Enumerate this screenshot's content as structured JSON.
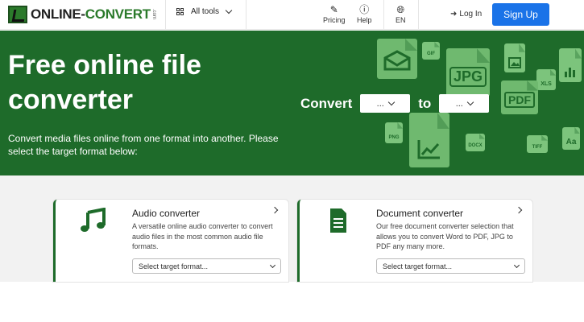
{
  "header": {
    "logo_text_a": "ONLINE-",
    "logo_text_b": "CONVERT",
    "logo_sub": ".com",
    "all_tools": "All tools",
    "pricing": "Pricing",
    "help": "Help",
    "lang": "EN",
    "login": "Log In",
    "signup": "Sign Up",
    "accent": "#1a73e8"
  },
  "hero": {
    "title": "Free online file converter",
    "subtitle": "Convert media files online from one format into another. Please select the target format below:",
    "convert_label": "Convert",
    "to_label": "to",
    "from_value": "...",
    "to_value": "...",
    "bg_color": "#1e6b2a",
    "file_labels": [
      "GIF",
      "JPG",
      "XLS",
      "PDF",
      "PNG",
      "DOCX",
      "TIFF"
    ]
  },
  "cards": [
    {
      "title": "Audio converter",
      "description": "A versatile online audio converter to convert audio files in the most common audio file formats.",
      "select_placeholder": "Select target format...",
      "icon": "music-note-icon"
    },
    {
      "title": "Document converter",
      "description": "Our free document converter selection that allows you to convert Word to PDF, JPG to PDF any many more.",
      "select_placeholder": "Select target format...",
      "icon": "document-icon"
    }
  ]
}
